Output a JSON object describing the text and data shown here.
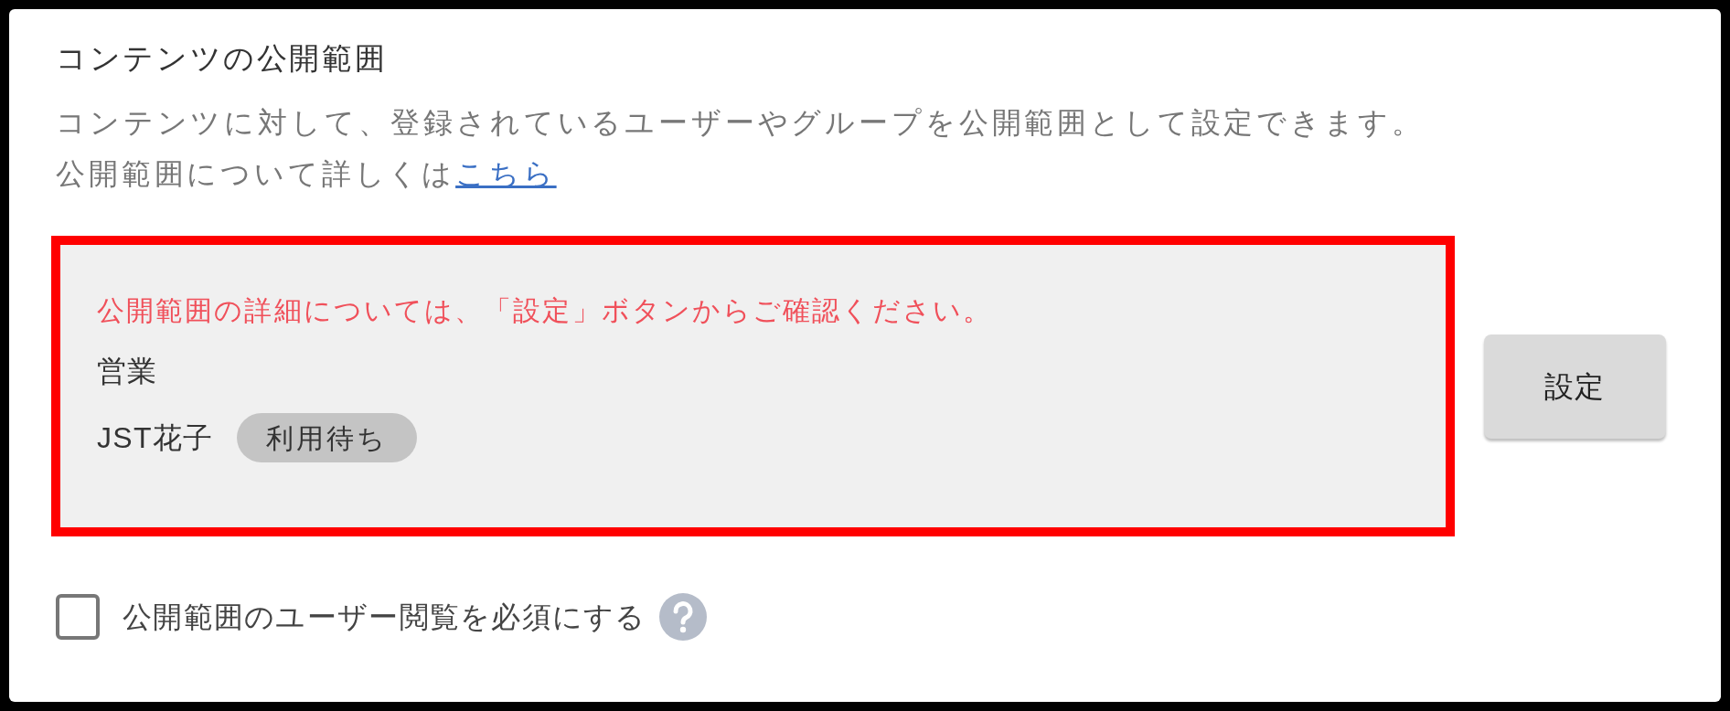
{
  "section": {
    "title": "コンテンツの公開範囲",
    "description": "コンテンツに対して、登録されているユーザーやグループを公開範囲として設定できます。",
    "help_text": "公開範囲について詳しくは",
    "help_link": "こちら"
  },
  "scope_panel": {
    "notice": "公開範囲の詳細については、「設定」ボタンからご確認ください。",
    "members": [
      {
        "name": "営業"
      },
      {
        "name": "JST花子",
        "badge": "利用待ち"
      }
    ]
  },
  "settings_button": "設定",
  "require_view": {
    "label": "公開範囲のユーザー閲覧を必須にする",
    "checked": false
  }
}
